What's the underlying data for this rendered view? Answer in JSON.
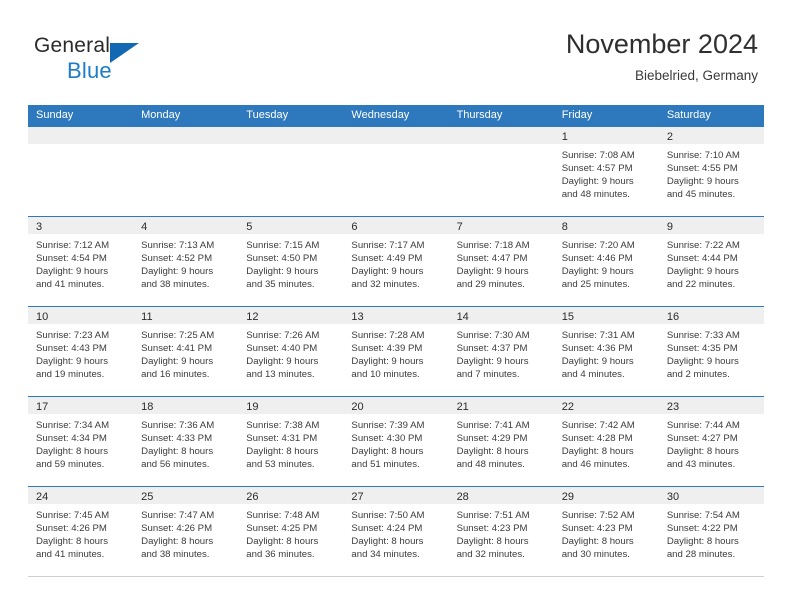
{
  "brand": {
    "name_top": "General",
    "name_bottom": "Blue",
    "triangle_color": "#1268b3",
    "blue_color": "#1d7dc8"
  },
  "header": {
    "title": "November 2024",
    "subtitle": "Biebelried, Germany"
  },
  "theme": {
    "header_blue": "#2e79bd",
    "daynum_band": "#efefef",
    "text": "#3c3c3c"
  },
  "weekdays": [
    "Sunday",
    "Monday",
    "Tuesday",
    "Wednesday",
    "Thursday",
    "Friday",
    "Saturday"
  ],
  "weeks": [
    [
      {
        "day": "",
        "lines": []
      },
      {
        "day": "",
        "lines": []
      },
      {
        "day": "",
        "lines": []
      },
      {
        "day": "",
        "lines": []
      },
      {
        "day": "",
        "lines": []
      },
      {
        "day": "1",
        "lines": [
          "Sunrise: 7:08 AM",
          "Sunset: 4:57 PM",
          "Daylight: 9 hours",
          "and 48 minutes."
        ]
      },
      {
        "day": "2",
        "lines": [
          "Sunrise: 7:10 AM",
          "Sunset: 4:55 PM",
          "Daylight: 9 hours",
          "and 45 minutes."
        ]
      }
    ],
    [
      {
        "day": "3",
        "lines": [
          "Sunrise: 7:12 AM",
          "Sunset: 4:54 PM",
          "Daylight: 9 hours",
          "and 41 minutes."
        ]
      },
      {
        "day": "4",
        "lines": [
          "Sunrise: 7:13 AM",
          "Sunset: 4:52 PM",
          "Daylight: 9 hours",
          "and 38 minutes."
        ]
      },
      {
        "day": "5",
        "lines": [
          "Sunrise: 7:15 AM",
          "Sunset: 4:50 PM",
          "Daylight: 9 hours",
          "and 35 minutes."
        ]
      },
      {
        "day": "6",
        "lines": [
          "Sunrise: 7:17 AM",
          "Sunset: 4:49 PM",
          "Daylight: 9 hours",
          "and 32 minutes."
        ]
      },
      {
        "day": "7",
        "lines": [
          "Sunrise: 7:18 AM",
          "Sunset: 4:47 PM",
          "Daylight: 9 hours",
          "and 29 minutes."
        ]
      },
      {
        "day": "8",
        "lines": [
          "Sunrise: 7:20 AM",
          "Sunset: 4:46 PM",
          "Daylight: 9 hours",
          "and 25 minutes."
        ]
      },
      {
        "day": "9",
        "lines": [
          "Sunrise: 7:22 AM",
          "Sunset: 4:44 PM",
          "Daylight: 9 hours",
          "and 22 minutes."
        ]
      }
    ],
    [
      {
        "day": "10",
        "lines": [
          "Sunrise: 7:23 AM",
          "Sunset: 4:43 PM",
          "Daylight: 9 hours",
          "and 19 minutes."
        ]
      },
      {
        "day": "11",
        "lines": [
          "Sunrise: 7:25 AM",
          "Sunset: 4:41 PM",
          "Daylight: 9 hours",
          "and 16 minutes."
        ]
      },
      {
        "day": "12",
        "lines": [
          "Sunrise: 7:26 AM",
          "Sunset: 4:40 PM",
          "Daylight: 9 hours",
          "and 13 minutes."
        ]
      },
      {
        "day": "13",
        "lines": [
          "Sunrise: 7:28 AM",
          "Sunset: 4:39 PM",
          "Daylight: 9 hours",
          "and 10 minutes."
        ]
      },
      {
        "day": "14",
        "lines": [
          "Sunrise: 7:30 AM",
          "Sunset: 4:37 PM",
          "Daylight: 9 hours",
          "and 7 minutes."
        ]
      },
      {
        "day": "15",
        "lines": [
          "Sunrise: 7:31 AM",
          "Sunset: 4:36 PM",
          "Daylight: 9 hours",
          "and 4 minutes."
        ]
      },
      {
        "day": "16",
        "lines": [
          "Sunrise: 7:33 AM",
          "Sunset: 4:35 PM",
          "Daylight: 9 hours",
          "and 2 minutes."
        ]
      }
    ],
    [
      {
        "day": "17",
        "lines": [
          "Sunrise: 7:34 AM",
          "Sunset: 4:34 PM",
          "Daylight: 8 hours",
          "and 59 minutes."
        ]
      },
      {
        "day": "18",
        "lines": [
          "Sunrise: 7:36 AM",
          "Sunset: 4:33 PM",
          "Daylight: 8 hours",
          "and 56 minutes."
        ]
      },
      {
        "day": "19",
        "lines": [
          "Sunrise: 7:38 AM",
          "Sunset: 4:31 PM",
          "Daylight: 8 hours",
          "and 53 minutes."
        ]
      },
      {
        "day": "20",
        "lines": [
          "Sunrise: 7:39 AM",
          "Sunset: 4:30 PM",
          "Daylight: 8 hours",
          "and 51 minutes."
        ]
      },
      {
        "day": "21",
        "lines": [
          "Sunrise: 7:41 AM",
          "Sunset: 4:29 PM",
          "Daylight: 8 hours",
          "and 48 minutes."
        ]
      },
      {
        "day": "22",
        "lines": [
          "Sunrise: 7:42 AM",
          "Sunset: 4:28 PM",
          "Daylight: 8 hours",
          "and 46 minutes."
        ]
      },
      {
        "day": "23",
        "lines": [
          "Sunrise: 7:44 AM",
          "Sunset: 4:27 PM",
          "Daylight: 8 hours",
          "and 43 minutes."
        ]
      }
    ],
    [
      {
        "day": "24",
        "lines": [
          "Sunrise: 7:45 AM",
          "Sunset: 4:26 PM",
          "Daylight: 8 hours",
          "and 41 minutes."
        ]
      },
      {
        "day": "25",
        "lines": [
          "Sunrise: 7:47 AM",
          "Sunset: 4:26 PM",
          "Daylight: 8 hours",
          "and 38 minutes."
        ]
      },
      {
        "day": "26",
        "lines": [
          "Sunrise: 7:48 AM",
          "Sunset: 4:25 PM",
          "Daylight: 8 hours",
          "and 36 minutes."
        ]
      },
      {
        "day": "27",
        "lines": [
          "Sunrise: 7:50 AM",
          "Sunset: 4:24 PM",
          "Daylight: 8 hours",
          "and 34 minutes."
        ]
      },
      {
        "day": "28",
        "lines": [
          "Sunrise: 7:51 AM",
          "Sunset: 4:23 PM",
          "Daylight: 8 hours",
          "and 32 minutes."
        ]
      },
      {
        "day": "29",
        "lines": [
          "Sunrise: 7:52 AM",
          "Sunset: 4:23 PM",
          "Daylight: 8 hours",
          "and 30 minutes."
        ]
      },
      {
        "day": "30",
        "lines": [
          "Sunrise: 7:54 AM",
          "Sunset: 4:22 PM",
          "Daylight: 8 hours",
          "and 28 minutes."
        ]
      }
    ]
  ]
}
